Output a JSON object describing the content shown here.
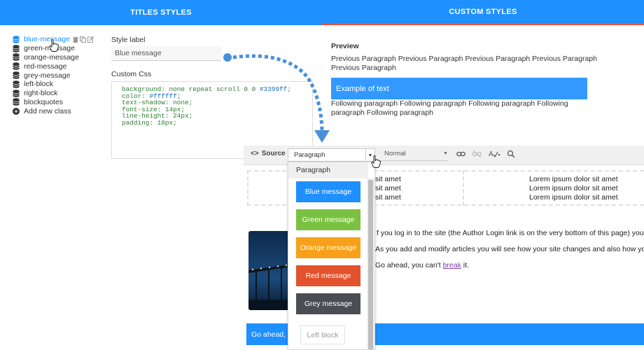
{
  "tabs": [
    {
      "label": "TITLES STYLES",
      "active": false
    },
    {
      "label": "CUSTOM STYLES",
      "active": true
    }
  ],
  "classes": {
    "items": [
      "blue-message",
      "green-message",
      "orange-message",
      "red-message",
      "grey-message",
      "left-block",
      "right-block",
      "blockquotes"
    ],
    "add_new": "Add new class"
  },
  "style_label": {
    "label": "Style label",
    "value": "Blue message"
  },
  "custom_css": {
    "label": "Custom Css",
    "line1_prefix": "background: none repeat scroll 0 0 ",
    "line1_hex": "#3399ff",
    "line1_suffix": ";",
    "line2_prefix": "color: ",
    "line2_hex": "#ffffff",
    "line2_suffix": ";",
    "line3": "text-shadow: none;",
    "line4": "font-size: 14px;",
    "line5": "line-height: 24px;",
    "line6": "padding: 10px;"
  },
  "preview": {
    "title": "Preview",
    "previous_paragraph": "Previous Paragraph Previous Paragraph Previous Paragraph Previous Paragraph Previous Paragraph",
    "example_text": "Example of text",
    "following_paragraph": "Following paragraph Following paragraph Following paragraph Following paragraph Following paragraph"
  },
  "editor": {
    "source_label": "Source",
    "paragraph_select": "Paragraph",
    "normal_select": "Normal",
    "lorem_left": "sit amet",
    "lorem_right": "Lorem ipsum dolor sit amet",
    "body_line1": "f you log in to the site (the Author Login link is on the very bottom of this page) you wi",
    "body_line2": "As you add and modify articles you will see how your site changes and also how you ca",
    "body_line3_prefix": "Go ahead, you can't ",
    "body_line3_link": "break",
    "body_line3_suffix": " it.",
    "bottom_bar_text": "Go ahead, y"
  },
  "dropdown": {
    "header": "Paragraph",
    "items": [
      {
        "label": "Blue message",
        "color": "#1e90ff"
      },
      {
        "label": "Green message",
        "color": "#7ac143"
      },
      {
        "label": "Orange message",
        "color": "#f7a11a"
      },
      {
        "label": "Red message",
        "color": "#e2532d"
      },
      {
        "label": "Grey message",
        "color": "#4a4e54"
      }
    ],
    "plain_item": "Left block"
  },
  "colors": {
    "accent": "#1e90ff",
    "active_tab_underline": "#e8533a",
    "arrow": "#4a90d9"
  },
  "icons": [
    "database-icon",
    "trash-icon",
    "copy-icon",
    "edit-icon",
    "plus-circle-icon",
    "code-icon",
    "link-icon",
    "unlink-icon",
    "spellcheck-icon",
    "search-replace-icon",
    "hand-pointer-icon"
  ]
}
